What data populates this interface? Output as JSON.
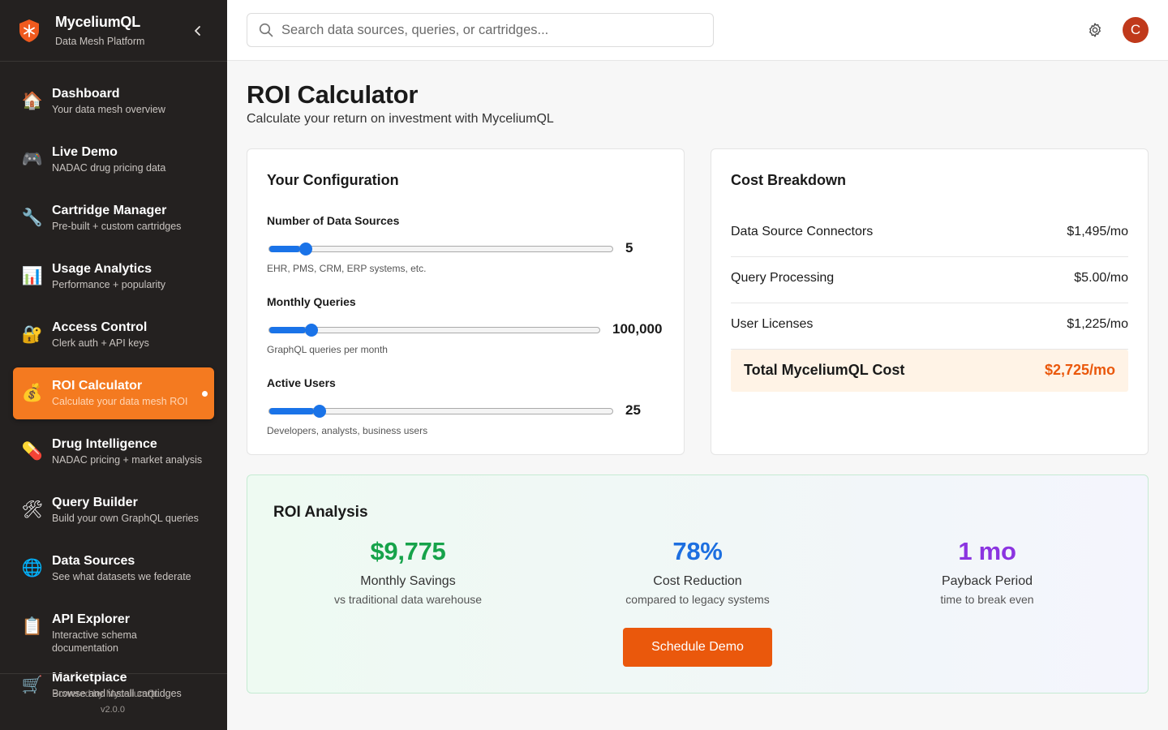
{
  "brand": {
    "name": "MyceliumQL",
    "subtitle": "Data Mesh Platform",
    "accent": "#f47a20"
  },
  "sidebar": {
    "items": [
      {
        "icon": "🏠",
        "icon_name": "house-icon",
        "title": "Dashboard",
        "subtitle": "Your data mesh overview",
        "active": false
      },
      {
        "icon": "🎮",
        "icon_name": "gamepad-icon",
        "title": "Live Demo",
        "subtitle": "NADAC drug pricing data",
        "active": false
      },
      {
        "icon": "🔧",
        "icon_name": "wrench-icon",
        "title": "Cartridge Manager",
        "subtitle": "Pre-built + custom cartridges",
        "active": false
      },
      {
        "icon": "📊",
        "icon_name": "bar-chart-icon",
        "title": "Usage Analytics",
        "subtitle": "Performance + popularity",
        "active": false
      },
      {
        "icon": "🔐",
        "icon_name": "lock-key-icon",
        "title": "Access Control",
        "subtitle": "Clerk auth + API keys",
        "active": false
      },
      {
        "icon": "💰",
        "icon_name": "money-bag-icon",
        "title": "ROI Calculator",
        "subtitle": "Calculate your data mesh ROI",
        "active": true
      },
      {
        "icon": "💊",
        "icon_name": "pill-icon",
        "title": "Drug Intelligence",
        "subtitle": "NADAC pricing + market analysis",
        "active": false
      },
      {
        "icon": "🛠",
        "icon_name": "hammer-wrench-icon",
        "title": "Query Builder",
        "subtitle": "Build your own GraphQL queries",
        "active": false
      },
      {
        "icon": "🌐",
        "icon_name": "globe-icon",
        "title": "Data Sources",
        "subtitle": "See what datasets we federate",
        "active": false
      },
      {
        "icon": "📋",
        "icon_name": "clipboard-icon",
        "title": "API Explorer",
        "subtitle": "Interactive schema documentation",
        "active": false
      },
      {
        "icon": "🛒",
        "icon_name": "cart-icon",
        "title": "Marketplace",
        "subtitle": "Browse and install cartridges",
        "active": false
      }
    ],
    "footer": {
      "text": "Powered by MyceliumQL",
      "version": "v2.0.0"
    }
  },
  "topbar": {
    "search_placeholder": "Search data sources, queries, or cartridges...",
    "avatar_initial": "C"
  },
  "page": {
    "title": "ROI Calculator",
    "subtitle": "Calculate your return on investment with MyceliumQL"
  },
  "config": {
    "title": "Your Configuration",
    "sliders": [
      {
        "label": "Number of Data Sources",
        "value": "5",
        "fill": 0.09,
        "hint": "EHR, PMS, CRM, ERP systems, etc."
      },
      {
        "label": "Monthly Queries",
        "value": "100,000",
        "fill": 0.11,
        "hint": "GraphQL queries per month"
      },
      {
        "label": "Active Users",
        "value": "25",
        "fill": 0.13,
        "hint": "Developers, analysts, business users"
      }
    ]
  },
  "breakdown": {
    "title": "Cost Breakdown",
    "rows": [
      {
        "label": "Data Source Connectors",
        "value": "$1,495/mo"
      },
      {
        "label": "Query Processing",
        "value": "$5.00/mo"
      },
      {
        "label": "User Licenses",
        "value": "$1,225/mo"
      }
    ],
    "total": {
      "label": "Total MyceliumQL Cost",
      "value": "$2,725/mo"
    }
  },
  "roi": {
    "title": "ROI Analysis",
    "metrics": [
      {
        "value": "$9,775",
        "label": "Monthly Savings",
        "sub": "vs traditional data warehouse",
        "color": "#16a34a"
      },
      {
        "value": "78%",
        "label": "Cost Reduction",
        "sub": "compared to legacy systems",
        "color": "#1d6fe0"
      },
      {
        "value": "1 mo",
        "label": "Payback Period",
        "sub": "time to break even",
        "color": "#8b34e0"
      }
    ],
    "cta": "Schedule Demo"
  }
}
